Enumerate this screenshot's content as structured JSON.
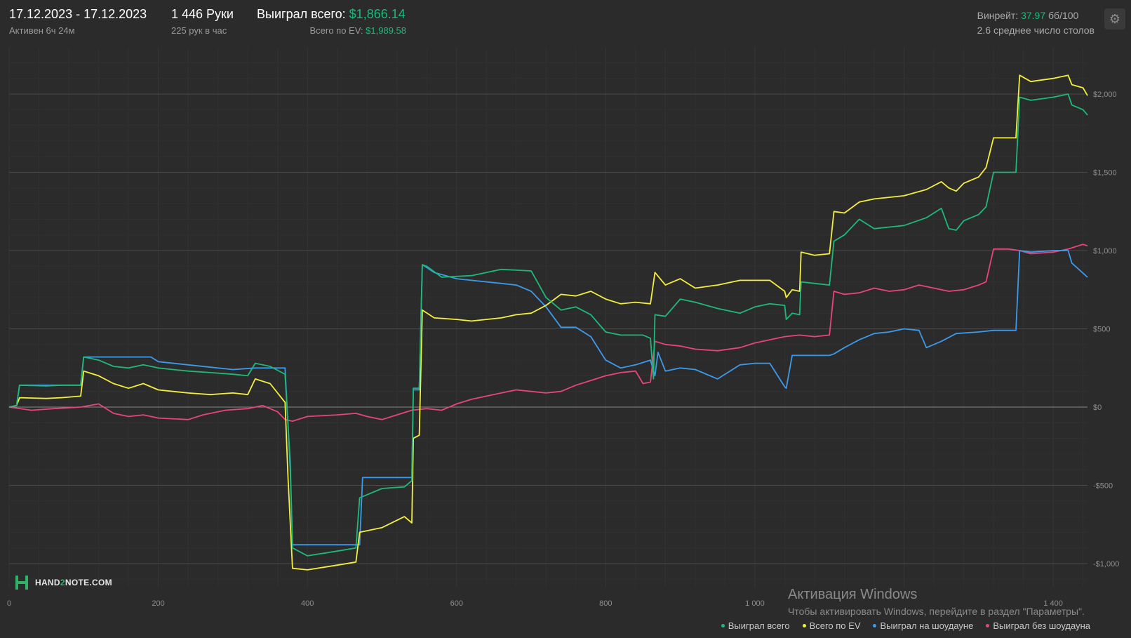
{
  "header": {
    "date_range": "17.12.2023 - 17.12.2023",
    "active_time": "Активен 6ч 24м",
    "hands": "1 446 Руки",
    "hands_per_hour": "225 рук в час",
    "won_total_label": "Выиграл всего:",
    "won_total_value": "$1,866.14",
    "ev_total_label": "Всего по EV:",
    "ev_total_value": "$1,989.58"
  },
  "stats": {
    "winrate_label": "Винрейт:",
    "winrate_value": "37.97",
    "winrate_unit": "бб/100",
    "avg_tables": "2.6 среднее число столов"
  },
  "settings_icon": "gear-icon",
  "logo": {
    "prefix": "HAND",
    "accent": "2",
    "suffix": "NOTE.COM"
  },
  "watermark": {
    "title": "Активация Windows",
    "subtitle": "Чтобы активировать Windows, перейдите в раздел \"Параметры\"."
  },
  "colors": {
    "background": "#2b2b2b",
    "won_total": "#1eb97a",
    "ev": "#f4ee3c",
    "showdown": "#3d9aeb",
    "non_showdown": "#e8457a"
  },
  "chart_data": {
    "type": "line",
    "xlim": [
      0,
      1446
    ],
    "ylim": [
      -1150,
      2300
    ],
    "x_ticks": [
      0,
      200,
      400,
      600,
      800,
      1000,
      1200,
      1400
    ],
    "x_tick_labels": [
      "0",
      "200",
      "400",
      "600",
      "800",
      "1 000",
      "",
      "1 400"
    ],
    "y_ticks": [
      -1000,
      -500,
      0,
      500,
      1000,
      1500,
      2000
    ],
    "y_tick_labels": [
      "-$1,000",
      "-$500",
      "$0",
      "$500",
      "$1,000",
      "$1,500",
      "$2,000"
    ],
    "grid": true,
    "legend_position": "bottom-right",
    "series": [
      {
        "name": "Выиграл всего",
        "color": "#1eb97a",
        "points": [
          [
            0,
            0
          ],
          [
            10,
            10
          ],
          [
            14,
            140
          ],
          [
            50,
            135
          ],
          [
            70,
            140
          ],
          [
            96,
            140
          ],
          [
            100,
            320
          ],
          [
            120,
            300
          ],
          [
            140,
            260
          ],
          [
            160,
            250
          ],
          [
            180,
            270
          ],
          [
            200,
            250
          ],
          [
            240,
            230
          ],
          [
            270,
            220
          ],
          [
            300,
            210
          ],
          [
            320,
            200
          ],
          [
            330,
            280
          ],
          [
            350,
            260
          ],
          [
            370,
            210
          ],
          [
            377,
            -350
          ],
          [
            380,
            -900
          ],
          [
            400,
            -950
          ],
          [
            440,
            -920
          ],
          [
            465,
            -900
          ],
          [
            470,
            -580
          ],
          [
            500,
            -520
          ],
          [
            530,
            -510
          ],
          [
            540,
            -470
          ],
          [
            542,
            120
          ],
          [
            550,
            120
          ],
          [
            554,
            910
          ],
          [
            560,
            900
          ],
          [
            580,
            830
          ],
          [
            620,
            840
          ],
          [
            660,
            880
          ],
          [
            680,
            875
          ],
          [
            700,
            870
          ],
          [
            720,
            700
          ],
          [
            740,
            620
          ],
          [
            760,
            640
          ],
          [
            780,
            590
          ],
          [
            800,
            480
          ],
          [
            820,
            460
          ],
          [
            850,
            460
          ],
          [
            860,
            440
          ],
          [
            864,
            180
          ],
          [
            866,
            590
          ],
          [
            880,
            580
          ],
          [
            900,
            690
          ],
          [
            920,
            670
          ],
          [
            950,
            630
          ],
          [
            980,
            600
          ],
          [
            1000,
            640
          ],
          [
            1020,
            660
          ],
          [
            1040,
            650
          ],
          [
            1042,
            560
          ],
          [
            1050,
            600
          ],
          [
            1060,
            590
          ],
          [
            1062,
            800
          ],
          [
            1080,
            790
          ],
          [
            1100,
            780
          ],
          [
            1106,
            1060
          ],
          [
            1120,
            1100
          ],
          [
            1140,
            1200
          ],
          [
            1160,
            1140
          ],
          [
            1200,
            1160
          ],
          [
            1230,
            1210
          ],
          [
            1250,
            1270
          ],
          [
            1260,
            1140
          ],
          [
            1270,
            1130
          ],
          [
            1280,
            1190
          ],
          [
            1300,
            1230
          ],
          [
            1310,
            1280
          ],
          [
            1320,
            1500
          ],
          [
            1350,
            1500
          ],
          [
            1355,
            1980
          ],
          [
            1370,
            1960
          ],
          [
            1400,
            1980
          ],
          [
            1420,
            2000
          ],
          [
            1425,
            1930
          ],
          [
            1440,
            1900
          ],
          [
            1446,
            1866
          ]
        ]
      },
      {
        "name": "Всего по EV",
        "color": "#f4ee3c",
        "points": [
          [
            0,
            0
          ],
          [
            10,
            10
          ],
          [
            14,
            60
          ],
          [
            50,
            55
          ],
          [
            70,
            60
          ],
          [
            96,
            70
          ],
          [
            100,
            230
          ],
          [
            120,
            200
          ],
          [
            140,
            150
          ],
          [
            160,
            120
          ],
          [
            180,
            150
          ],
          [
            200,
            110
          ],
          [
            240,
            90
          ],
          [
            270,
            80
          ],
          [
            300,
            90
          ],
          [
            320,
            80
          ],
          [
            330,
            180
          ],
          [
            350,
            150
          ],
          [
            370,
            30
          ],
          [
            374,
            -450
          ],
          [
            380,
            -1030
          ],
          [
            400,
            -1040
          ],
          [
            440,
            -1010
          ],
          [
            465,
            -990
          ],
          [
            470,
            -800
          ],
          [
            500,
            -770
          ],
          [
            530,
            -700
          ],
          [
            540,
            -740
          ],
          [
            542,
            -200
          ],
          [
            550,
            -180
          ],
          [
            554,
            620
          ],
          [
            570,
            570
          ],
          [
            600,
            560
          ],
          [
            620,
            550
          ],
          [
            660,
            570
          ],
          [
            680,
            590
          ],
          [
            700,
            600
          ],
          [
            720,
            650
          ],
          [
            740,
            720
          ],
          [
            760,
            710
          ],
          [
            780,
            740
          ],
          [
            800,
            690
          ],
          [
            820,
            660
          ],
          [
            840,
            670
          ],
          [
            860,
            660
          ],
          [
            866,
            860
          ],
          [
            880,
            780
          ],
          [
            900,
            820
          ],
          [
            920,
            760
          ],
          [
            950,
            780
          ],
          [
            980,
            810
          ],
          [
            1000,
            810
          ],
          [
            1020,
            810
          ],
          [
            1040,
            740
          ],
          [
            1042,
            700
          ],
          [
            1050,
            750
          ],
          [
            1060,
            740
          ],
          [
            1062,
            990
          ],
          [
            1080,
            970
          ],
          [
            1100,
            980
          ],
          [
            1106,
            1250
          ],
          [
            1120,
            1240
          ],
          [
            1140,
            1310
          ],
          [
            1160,
            1330
          ],
          [
            1200,
            1350
          ],
          [
            1230,
            1390
          ],
          [
            1250,
            1440
          ],
          [
            1260,
            1400
          ],
          [
            1270,
            1380
          ],
          [
            1280,
            1430
          ],
          [
            1300,
            1470
          ],
          [
            1310,
            1530
          ],
          [
            1320,
            1720
          ],
          [
            1350,
            1720
          ],
          [
            1355,
            2120
          ],
          [
            1370,
            2080
          ],
          [
            1400,
            2100
          ],
          [
            1420,
            2120
          ],
          [
            1425,
            2060
          ],
          [
            1440,
            2040
          ],
          [
            1446,
            1990
          ]
        ]
      },
      {
        "name": "Выиграл на шоудауне",
        "color": "#3d9aeb",
        "points": [
          [
            0,
            0
          ],
          [
            10,
            10
          ],
          [
            14,
            140
          ],
          [
            96,
            140
          ],
          [
            100,
            320
          ],
          [
            190,
            320
          ],
          [
            200,
            290
          ],
          [
            240,
            270
          ],
          [
            300,
            240
          ],
          [
            330,
            250
          ],
          [
            370,
            250
          ],
          [
            377,
            -400
          ],
          [
            380,
            -880
          ],
          [
            440,
            -880
          ],
          [
            470,
            -880
          ],
          [
            474,
            -450
          ],
          [
            540,
            -450
          ],
          [
            542,
            110
          ],
          [
            550,
            110
          ],
          [
            554,
            910
          ],
          [
            570,
            860
          ],
          [
            600,
            820
          ],
          [
            620,
            810
          ],
          [
            660,
            790
          ],
          [
            680,
            780
          ],
          [
            700,
            740
          ],
          [
            720,
            640
          ],
          [
            740,
            510
          ],
          [
            760,
            510
          ],
          [
            780,
            450
          ],
          [
            800,
            300
          ],
          [
            820,
            250
          ],
          [
            840,
            270
          ],
          [
            860,
            300
          ],
          [
            866,
            200
          ],
          [
            870,
            350
          ],
          [
            880,
            230
          ],
          [
            900,
            250
          ],
          [
            920,
            240
          ],
          [
            950,
            180
          ],
          [
            980,
            270
          ],
          [
            1000,
            280
          ],
          [
            1020,
            280
          ],
          [
            1040,
            130
          ],
          [
            1042,
            120
          ],
          [
            1050,
            330
          ],
          [
            1080,
            330
          ],
          [
            1100,
            330
          ],
          [
            1106,
            340
          ],
          [
            1120,
            380
          ],
          [
            1140,
            430
          ],
          [
            1160,
            470
          ],
          [
            1180,
            480
          ],
          [
            1200,
            500
          ],
          [
            1220,
            490
          ],
          [
            1230,
            380
          ],
          [
            1250,
            420
          ],
          [
            1270,
            470
          ],
          [
            1300,
            480
          ],
          [
            1320,
            490
          ],
          [
            1350,
            490
          ],
          [
            1355,
            1000
          ],
          [
            1370,
            990
          ],
          [
            1400,
            1000
          ],
          [
            1420,
            1000
          ],
          [
            1425,
            920
          ],
          [
            1446,
            830
          ]
        ]
      },
      {
        "name": "Выиграл без шоудауна",
        "color": "#e8457a",
        "points": [
          [
            0,
            0
          ],
          [
            30,
            -20
          ],
          [
            60,
            -10
          ],
          [
            96,
            0
          ],
          [
            120,
            20
          ],
          [
            140,
            -40
          ],
          [
            160,
            -60
          ],
          [
            180,
            -50
          ],
          [
            200,
            -70
          ],
          [
            240,
            -80
          ],
          [
            260,
            -50
          ],
          [
            290,
            -20
          ],
          [
            320,
            -10
          ],
          [
            340,
            10
          ],
          [
            360,
            -30
          ],
          [
            370,
            -80
          ],
          [
            380,
            -90
          ],
          [
            400,
            -60
          ],
          [
            440,
            -50
          ],
          [
            465,
            -40
          ],
          [
            480,
            -60
          ],
          [
            500,
            -80
          ],
          [
            520,
            -50
          ],
          [
            540,
            -20
          ],
          [
            560,
            -10
          ],
          [
            580,
            -20
          ],
          [
            600,
            20
          ],
          [
            620,
            50
          ],
          [
            640,
            70
          ],
          [
            660,
            90
          ],
          [
            680,
            110
          ],
          [
            700,
            100
          ],
          [
            720,
            90
          ],
          [
            740,
            100
          ],
          [
            760,
            140
          ],
          [
            780,
            170
          ],
          [
            800,
            200
          ],
          [
            820,
            220
          ],
          [
            840,
            230
          ],
          [
            850,
            150
          ],
          [
            860,
            160
          ],
          [
            866,
            420
          ],
          [
            880,
            400
          ],
          [
            900,
            390
          ],
          [
            920,
            370
          ],
          [
            950,
            360
          ],
          [
            980,
            380
          ],
          [
            1000,
            410
          ],
          [
            1020,
            430
          ],
          [
            1040,
            450
          ],
          [
            1060,
            460
          ],
          [
            1080,
            450
          ],
          [
            1100,
            460
          ],
          [
            1106,
            740
          ],
          [
            1120,
            720
          ],
          [
            1140,
            730
          ],
          [
            1160,
            760
          ],
          [
            1180,
            740
          ],
          [
            1200,
            750
          ],
          [
            1220,
            780
          ],
          [
            1240,
            760
          ],
          [
            1260,
            740
          ],
          [
            1280,
            750
          ],
          [
            1300,
            780
          ],
          [
            1310,
            800
          ],
          [
            1320,
            1010
          ],
          [
            1340,
            1010
          ],
          [
            1355,
            1000
          ],
          [
            1370,
            980
          ],
          [
            1400,
            990
          ],
          [
            1420,
            1010
          ],
          [
            1440,
            1040
          ],
          [
            1446,
            1030
          ]
        ]
      }
    ]
  }
}
